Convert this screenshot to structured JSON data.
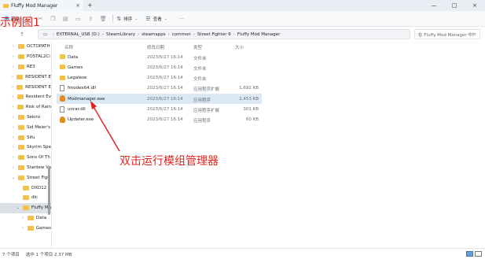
{
  "window": {
    "tab_title": "Fluffy Mod Manager",
    "tab_close": "×",
    "new_tab": "+",
    "controls": [
      "—",
      "□",
      "×"
    ]
  },
  "toolbar": {
    "new_label": "新建",
    "new_caret": "⌄",
    "icons": [
      "cut-icon",
      "copy-icon",
      "paste-icon",
      "rename-icon",
      "share-icon",
      "delete-icon"
    ],
    "sort_label": "排序",
    "view_label": "查看",
    "more": "···"
  },
  "annotation": {
    "label": "示例图1",
    "instruction": "双击运行模组管理器",
    "color": "#e0241d"
  },
  "address": {
    "crumbs": [
      "EXTERNAL_USB (D:)",
      "SteamLibrary",
      "steamapps",
      "common",
      "Street Fighter 6",
      "Fluffy Mod Manager"
    ],
    "search_placeholder": "在 Fluffy Mod Manager 中搜索"
  },
  "nav": {
    "items": [
      {
        "label": "OCTOPATH",
        "chevron": "›"
      },
      {
        "label": "POSTAL2Ci",
        "chevron": "›"
      },
      {
        "label": "RE3",
        "chevron": "›"
      },
      {
        "label": "RESIDENT E",
        "chevron": "›"
      },
      {
        "label": "RESIDENT E",
        "chevron": "›"
      },
      {
        "label": "Resident Ev",
        "chevron": "›"
      },
      {
        "label": "Risk of Rain",
        "chevron": "›"
      },
      {
        "label": "Sekiro",
        "chevron": "›"
      },
      {
        "label": "Sid Meier's",
        "chevron": "›"
      },
      {
        "label": "Sifu",
        "chevron": "›"
      },
      {
        "label": "Skyrim Spe",
        "chevron": "›"
      },
      {
        "label": "Sons Of Th",
        "chevron": "›"
      },
      {
        "label": "Stardew Va",
        "chevron": "›"
      },
      {
        "label": "Street Figh",
        "chevron": "⌄"
      },
      {
        "label": "DXD12",
        "chevron": ""
      },
      {
        "label": "dlc",
        "chevron": ""
      },
      {
        "label": "Fluffy Ma",
        "chevron": "⌄"
      },
      {
        "label": "Data",
        "chevron": "›"
      },
      {
        "label": "Games",
        "chevron": "›"
      }
    ]
  },
  "files": {
    "headers": {
      "name": "名称",
      "date": "修改日期",
      "type": "类型",
      "size": "大小"
    },
    "rows": [
      {
        "icon": "folder-icon",
        "name": "Data",
        "date": "2023/6/27 16:14",
        "type": "文件夹",
        "size": ""
      },
      {
        "icon": "folder-icon",
        "name": "Games",
        "date": "2023/6/27 16:14",
        "type": "文件夹",
        "size": ""
      },
      {
        "icon": "folder-icon",
        "name": "Legalese",
        "date": "2023/6/27 16:14",
        "type": "文件夹",
        "size": ""
      },
      {
        "icon": "dll-file-icon",
        "name": "fmodex64.dll",
        "date": "2023/6/27 16:14",
        "type": "应用程序扩展",
        "size": "1,692 KB"
      },
      {
        "icon": "exe-icon",
        "name": "Modmanager.exe",
        "date": "2023/6/27 16:14",
        "type": "应用程序",
        "size": "2,453 KB"
      },
      {
        "icon": "dll-file-icon",
        "name": "unrar.dll",
        "date": "2023/6/27 16:14",
        "type": "应用程序扩展",
        "size": "301 KB"
      },
      {
        "icon": "exe-icon",
        "name": "Updater.exe",
        "date": "2023/6/27 16:14",
        "type": "应用程序",
        "size": "60 KB"
      }
    ]
  },
  "status": {
    "count": "7 个项目",
    "selected": "选中 1 个项目 2.37 MB"
  }
}
